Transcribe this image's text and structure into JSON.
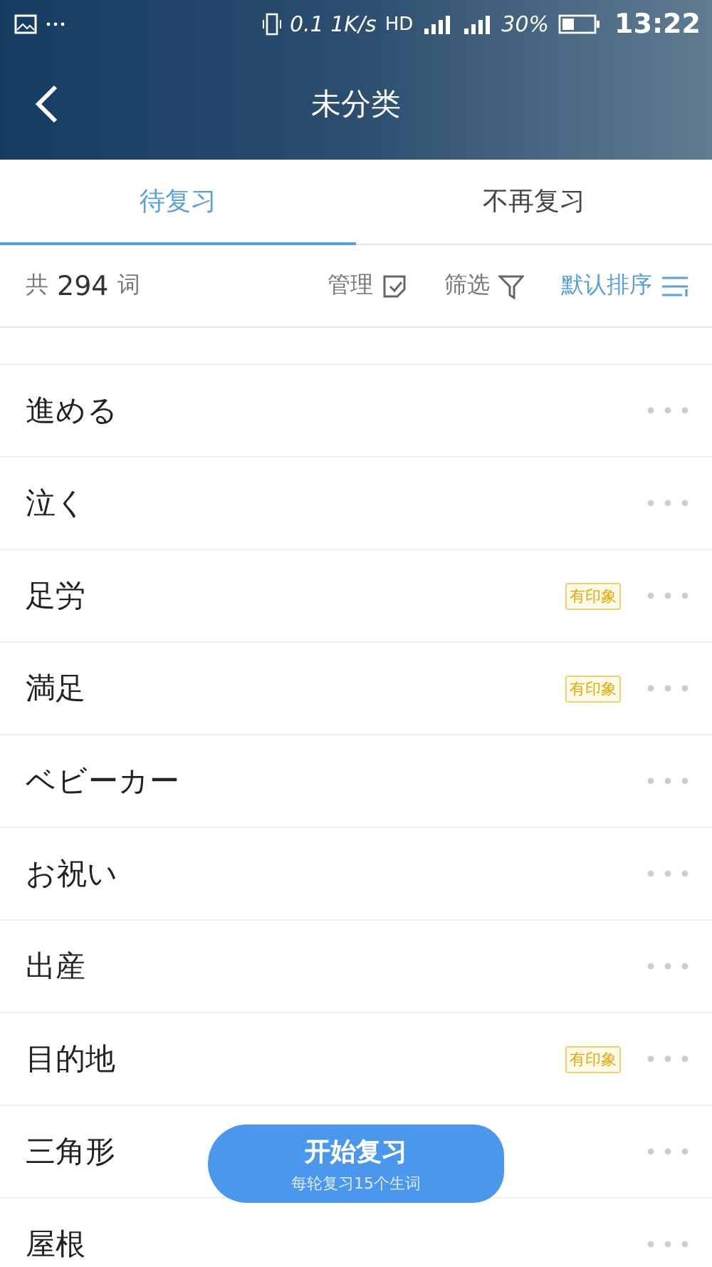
{
  "status_bar": {
    "speed": "0.1 1K/s",
    "hd": "HD",
    "battery": "30%",
    "time": "13:22"
  },
  "header": {
    "title": "未分类"
  },
  "tabs": [
    {
      "label": "待复习",
      "selected": true
    },
    {
      "label": "不再复习",
      "selected": false
    }
  ],
  "toolbar": {
    "count_prefix": "共",
    "count": "294",
    "count_suffix": "词",
    "manage": "管理",
    "filter": "筛选",
    "sort": "默认排序"
  },
  "words": [
    {
      "word": "進める"
    },
    {
      "word": "泣く"
    },
    {
      "word": "足労",
      "tag": "有印象"
    },
    {
      "word": "満足",
      "tag": "有印象"
    },
    {
      "word": "ベビーカー"
    },
    {
      "word": "お祝い"
    },
    {
      "word": "出産"
    },
    {
      "word": "目的地",
      "tag": "有印象"
    },
    {
      "word": "三角形"
    },
    {
      "word": "屋根"
    }
  ],
  "start_button": {
    "label": "开始复习",
    "sublabel": "每轮复习15个生词"
  }
}
